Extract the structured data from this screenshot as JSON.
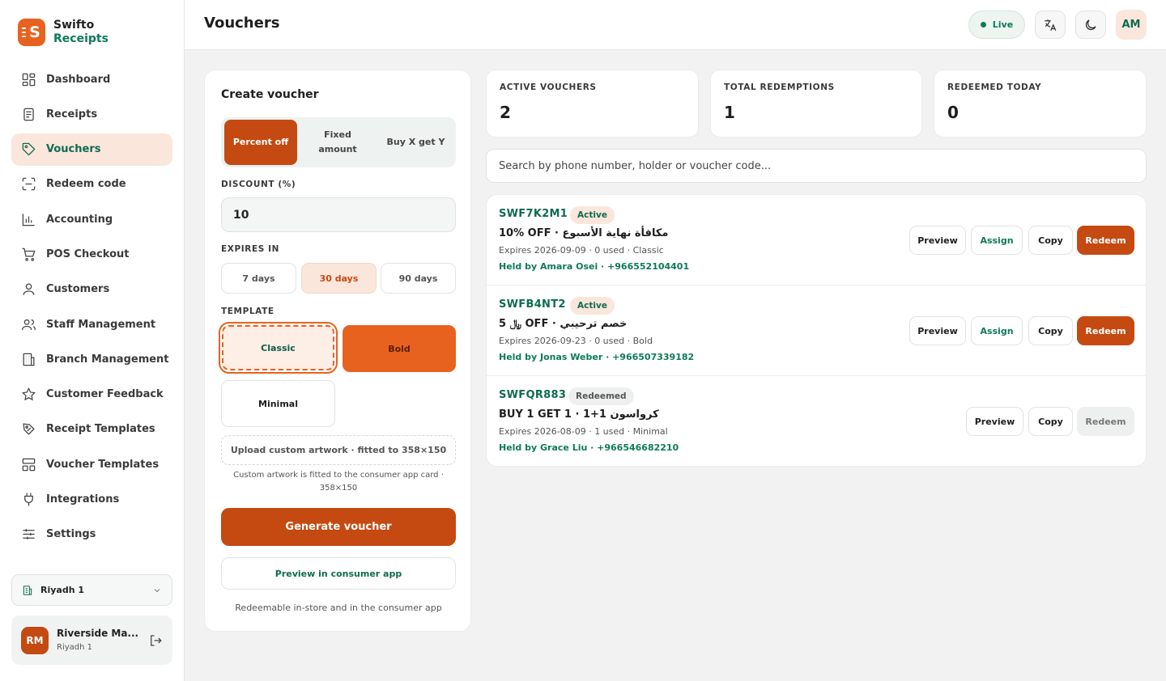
{
  "brand": {
    "name": "Swifto",
    "sub": "Receipts",
    "logo_letter": "S"
  },
  "sidebar": {
    "items": [
      {
        "label": "Dashboard",
        "icon": "grid-icon"
      },
      {
        "label": "Receipts",
        "icon": "receipt-icon"
      },
      {
        "label": "Vouchers",
        "icon": "tag-icon",
        "active": true
      },
      {
        "label": "Redeem code",
        "icon": "scan-icon"
      },
      {
        "label": "Accounting",
        "icon": "bar-chart-icon"
      },
      {
        "label": "POS Checkout",
        "icon": "cart-icon"
      },
      {
        "label": "Customers",
        "icon": "user-icon"
      },
      {
        "label": "Staff Management",
        "icon": "users-icon"
      },
      {
        "label": "Branch Management",
        "icon": "building-icon"
      },
      {
        "label": "Customer Feedback",
        "icon": "star-icon"
      },
      {
        "label": "Receipt Templates",
        "icon": "template-tag-icon"
      },
      {
        "label": "Voucher Templates",
        "icon": "layout-icon"
      },
      {
        "label": "Integrations",
        "icon": "plug-icon"
      },
      {
        "label": "Settings",
        "icon": "sliders-icon"
      }
    ],
    "branch_select": "Riyadh 1",
    "user": {
      "initials": "RM",
      "name": "Riverside Ma...",
      "branch": "Riyadh 1"
    }
  },
  "header": {
    "title": "Vouchers",
    "live_label": "Live",
    "avatar": "AM"
  },
  "create": {
    "title": "Create voucher",
    "types": [
      "Percent off",
      "Fixed amount",
      "Buy X get Y"
    ],
    "discount_label": "DISCOUNT (%)",
    "discount_value": "10",
    "expires_label": "EXPIRES IN",
    "expiry_options": [
      "7 days",
      "30 days",
      "90 days"
    ],
    "template_label": "TEMPLATE",
    "templates": [
      "Classic",
      "Bold",
      "Minimal"
    ],
    "upload_label": "Upload custom artwork · fitted to 358×150",
    "upload_note": "Custom artwork is fitted to the consumer app card · 358×150",
    "generate_label": "Generate voucher",
    "preview_label": "Preview in consumer app",
    "redeem_note": "Redeemable in-store and in the consumer app"
  },
  "stats": [
    {
      "label": "ACTIVE VOUCHERS",
      "value": "2"
    },
    {
      "label": "TOTAL REDEMPTIONS",
      "value": "1"
    },
    {
      "label": "REDEEMED TODAY",
      "value": "0"
    }
  ],
  "search": {
    "placeholder": "Search by phone number, holder or voucher code..."
  },
  "vouchers": [
    {
      "code": "SWF7K2M1",
      "status": "Active",
      "title": "10% OFF · مكافأة نهاية الأسبوع",
      "meta": "Expires 2026-09-09 · 0 used · Classic",
      "held": "Held by Amara Osei · +966552104401"
    },
    {
      "code": "SWFB4NT2",
      "status": "Active",
      "title": "5 ﷼ OFF · خصم ترحيبي",
      "meta": "Expires 2026-09-23 · 0 used · Bold",
      "held": "Held by Jonas Weber · +966507339182"
    },
    {
      "code": "SWFQR883",
      "status": "Redeemed",
      "title": "BUY 1 GET 1 · كرواسون 1+1",
      "meta": "Expires 2026-08-09 · 1 used · Minimal",
      "held": "Held by Grace Liu · +966546682210"
    }
  ],
  "actions": {
    "preview": "Preview",
    "assign": "Assign",
    "copy": "Copy",
    "redeem": "Redeem"
  },
  "colors": {
    "accent": "#c44a12",
    "accent_light": "#e8621f",
    "brand_green": "#0e7a5a",
    "active_bg": "#fbe6dc"
  }
}
